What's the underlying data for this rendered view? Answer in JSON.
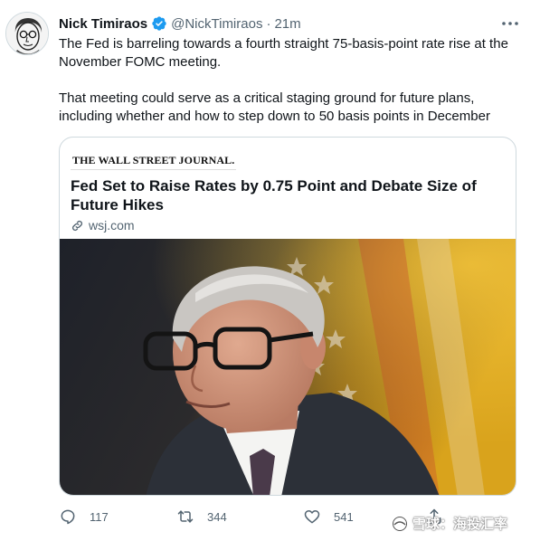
{
  "author": {
    "display_name": "Nick Timiraos",
    "handle": "@NickTimiraos",
    "separator": "·",
    "time": "21m",
    "verified": true
  },
  "tweet": {
    "paragraphs": [
      "The Fed is barreling towards a fourth straight 75-basis-point rate rise at the November FOMC meeting.",
      "That meeting could serve as a critical staging ground for future plans, including whether and how to step down to 50 basis points in December"
    ]
  },
  "card": {
    "publisher_logo": "THE WALL STREET JOURNAL.",
    "title": "Fed Set to Raise Rates by 0.75 Point and Debate Size of Future Hikes",
    "domain": "wsj.com"
  },
  "actions": {
    "reply_count": "117",
    "retweet_count": "344",
    "like_count": "541"
  },
  "watermark": {
    "text": "雪球：海投汇率"
  },
  "colors": {
    "verified_blue": "#1d9bf0",
    "secondary_text": "#536471",
    "border": "#cfd9de"
  },
  "icons": [
    "verified-badge-icon",
    "more-icon",
    "link-icon",
    "reply-icon",
    "retweet-icon",
    "like-icon",
    "share-icon",
    "snowball-logo-icon"
  ]
}
